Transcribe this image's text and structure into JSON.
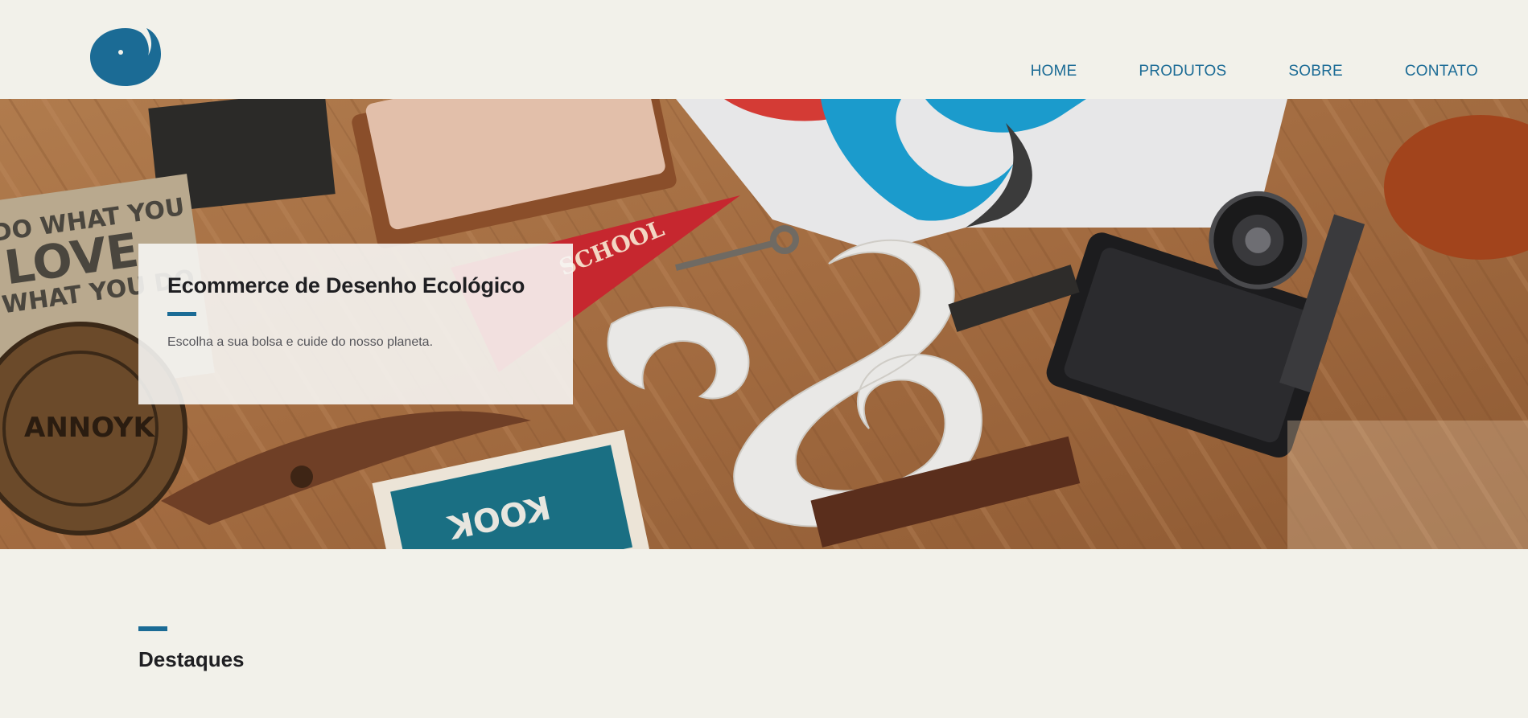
{
  "brand": {
    "logo_icon": "spiral-logo-icon",
    "color": "#1b6b95"
  },
  "nav": {
    "items": [
      {
        "label": "HOME"
      },
      {
        "label": "PRODUTOS"
      },
      {
        "label": "SOBRE"
      },
      {
        "label": "CONTATO"
      }
    ]
  },
  "hero": {
    "title": "Ecommerce de Desenho Ecológico",
    "subtitle": "Escolha a sua bolsa e cuide do nosso planeta."
  },
  "featured": {
    "title": "Destaques"
  },
  "colors": {
    "background": "#f2f1ea",
    "accent": "#1b6b95",
    "text": "#1f1f22"
  }
}
